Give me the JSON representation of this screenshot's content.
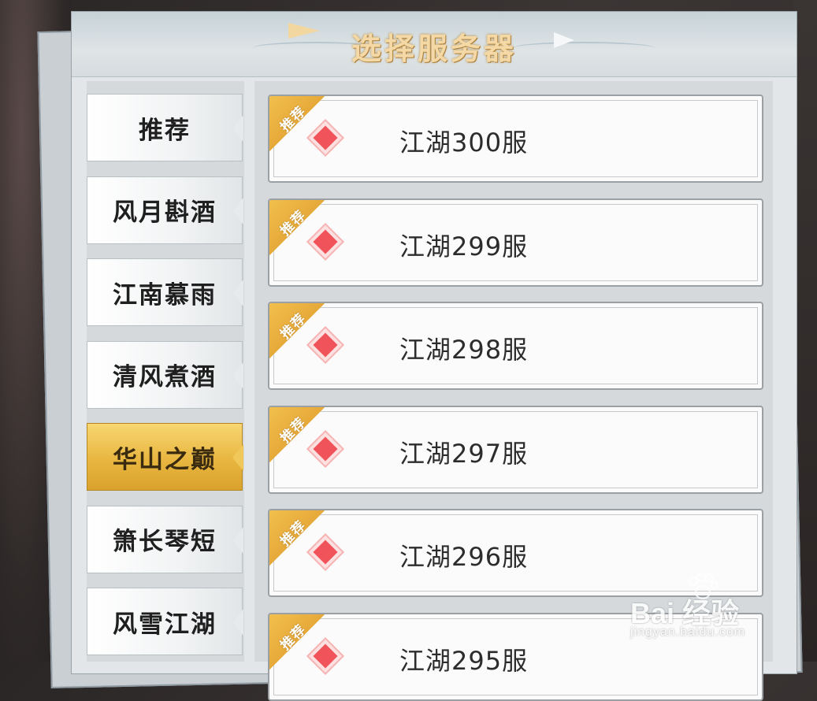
{
  "title": "选择服务器",
  "categories": [
    {
      "label": "推荐",
      "active": false
    },
    {
      "label": "风月斟酒",
      "active": false
    },
    {
      "label": "江南慕雨",
      "active": false
    },
    {
      "label": "清风煮酒",
      "active": false
    },
    {
      "label": "华山之巅",
      "active": true
    },
    {
      "label": "箫长琴短",
      "active": false
    },
    {
      "label": "风雪江湖",
      "active": false
    }
  ],
  "servers": [
    {
      "name": "江湖300服",
      "badge": "推荐"
    },
    {
      "name": "江湖299服",
      "badge": "推荐"
    },
    {
      "name": "江湖298服",
      "badge": "推荐"
    },
    {
      "name": "江湖297服",
      "badge": "推荐"
    },
    {
      "name": "江湖296服",
      "badge": "推荐"
    },
    {
      "name": "江湖295服",
      "badge": "推荐"
    }
  ],
  "watermark": {
    "main": "Bai 经验",
    "sub": "jingyan.baidu.com"
  },
  "colors": {
    "accent": "#e8b640",
    "status_dot": "#f0545a",
    "ribbon": "#f2c04e"
  }
}
